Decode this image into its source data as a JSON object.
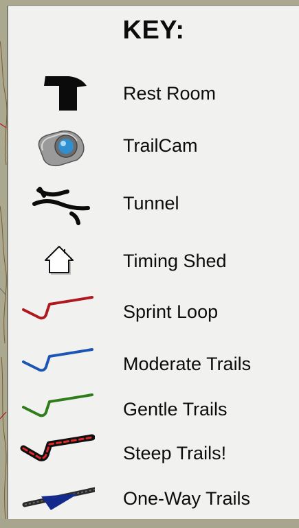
{
  "key": {
    "title": "KEY:",
    "items": [
      {
        "icon": "restroom-icon",
        "label": "Rest Room"
      },
      {
        "icon": "trailcam-icon",
        "label": "TrailCam"
      },
      {
        "icon": "tunnel-icon",
        "label": "Tunnel"
      },
      {
        "icon": "timing-shed-icon",
        "label": "Timing Shed"
      },
      {
        "icon": "sprint-loop-line-icon",
        "label": "Sprint Loop",
        "color": "#b01820"
      },
      {
        "icon": "moderate-trail-line-icon",
        "label": "Moderate Trails",
        "color": "#1c56b4"
      },
      {
        "icon": "gentle-trail-line-icon",
        "label": "Gentle Trails",
        "color": "#2f7d1a"
      },
      {
        "icon": "steep-trail-line-icon",
        "label": "Steep Trails!",
        "color": "#111111",
        "dash_color": "#e02828"
      },
      {
        "icon": "one-way-trail-icon",
        "label": "One-Way Trails",
        "color": "#2a2a2a",
        "arrow_color": "#132a8c"
      }
    ]
  }
}
